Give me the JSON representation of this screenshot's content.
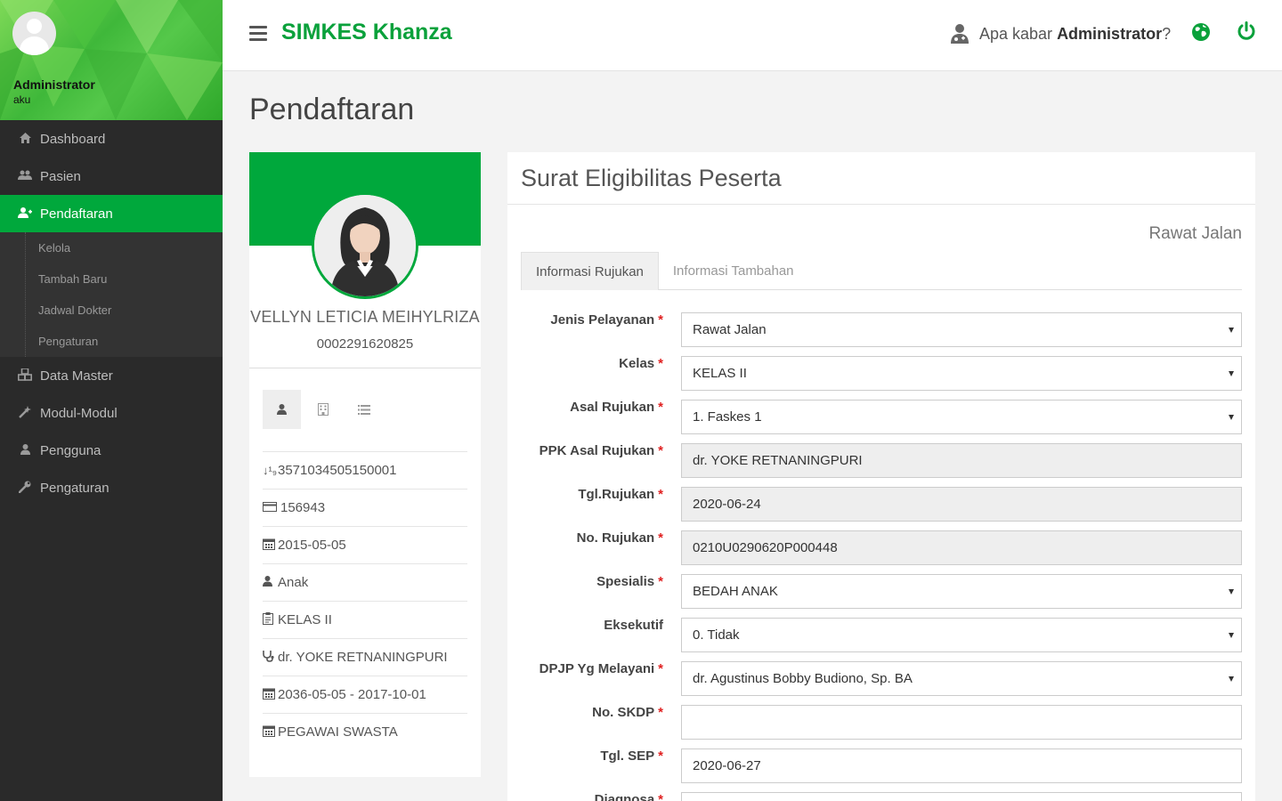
{
  "sidebar": {
    "user_name": "Administrator",
    "user_role": "aku",
    "items": [
      {
        "label": "Dashboard",
        "icon": "home-icon"
      },
      {
        "label": "Pasien",
        "icon": "users-icon"
      },
      {
        "label": "Pendaftaran",
        "icon": "user-plus-icon",
        "active": true
      },
      {
        "label": "Data Master",
        "icon": "cubes-icon"
      },
      {
        "label": "Modul-Modul",
        "icon": "magic-icon"
      },
      {
        "label": "Pengguna",
        "icon": "user-icon"
      },
      {
        "label": "Pengaturan",
        "icon": "wrench-icon"
      }
    ],
    "subitems": [
      "Kelola",
      "Tambah Baru",
      "Jadwal Dokter",
      "Pengaturan"
    ]
  },
  "header": {
    "brand": "SIMKES Khanza",
    "greeting_prefix": "Apa kabar ",
    "greeting_user": "Administrator",
    "greeting_suffix": "?"
  },
  "page": {
    "title": "Pendaftaran"
  },
  "profile": {
    "name": "VELLYN LETICIA MEIHYLRIZA",
    "id": "0002291620825",
    "details": [
      {
        "icon": "sort-numeric-icon",
        "value": "3571034505150001"
      },
      {
        "icon": "credit-card-icon",
        "value": "156943"
      },
      {
        "icon": "calendar-icon",
        "value": "2015-05-05"
      },
      {
        "icon": "user-icon",
        "value": "Anak"
      },
      {
        "icon": "clipboard-icon",
        "value": "KELAS II"
      },
      {
        "icon": "stethoscope-icon",
        "value": "dr. YOKE RETNANINGPURI"
      },
      {
        "icon": "calendar-icon",
        "value": "2036-05-05 - 2017-10-01"
      },
      {
        "icon": "calendar-icon",
        "value": "PEGAWAI SWASTA"
      }
    ]
  },
  "form": {
    "title": "Surat Eligibilitas Peserta",
    "kind": "Rawat Jalan",
    "tabs": [
      "Informasi Rujukan",
      "Informasi Tambahan"
    ],
    "fields": [
      {
        "label": "Jenis Pelayanan",
        "required": true,
        "value": "Rawat Jalan",
        "type": "select"
      },
      {
        "label": "Kelas",
        "required": true,
        "value": "KELAS II",
        "type": "select"
      },
      {
        "label": "Asal Rujukan",
        "required": true,
        "value": "1. Faskes 1",
        "type": "select"
      },
      {
        "label": "PPK Asal Rujukan",
        "required": true,
        "value": "dr. YOKE RETNANINGPURI",
        "type": "readonly"
      },
      {
        "label": "Tgl.Rujukan",
        "required": true,
        "value": "2020-06-24",
        "type": "readonly"
      },
      {
        "label": "No. Rujukan",
        "required": true,
        "value": "0210U0290620P000448",
        "type": "readonly"
      },
      {
        "label": "Spesialis",
        "required": true,
        "value": "BEDAH ANAK",
        "type": "select"
      },
      {
        "label": "Eksekutif",
        "required": false,
        "value": "0. Tidak",
        "type": "select"
      },
      {
        "label": "DPJP Yg Melayani",
        "required": true,
        "value": "dr. Agustinus Bobby Budiono, Sp. BA",
        "type": "select"
      },
      {
        "label": "No. SKDP",
        "required": true,
        "value": "",
        "type": "text"
      },
      {
        "label": "Tgl. SEP",
        "required": true,
        "value": "2020-06-27",
        "type": "text"
      },
      {
        "label": "Diagnosa",
        "required": true,
        "value": "",
        "type": "text"
      }
    ],
    "required_mark": "*"
  },
  "colors": {
    "brand_green": "#00a83c",
    "sidebar_bg": "#2a2a2a",
    "required_red": "#e02020"
  }
}
